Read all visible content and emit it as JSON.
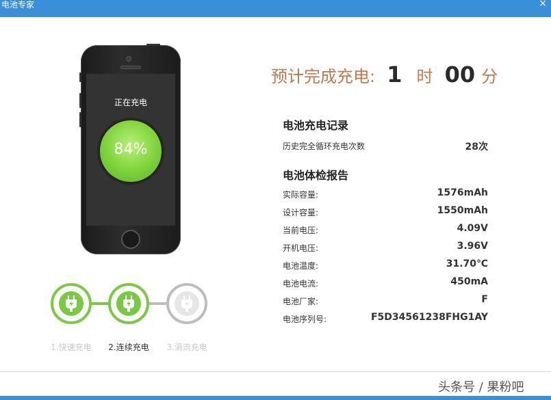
{
  "window": {
    "title": "电池专家",
    "close_glyph": "×"
  },
  "phone": {
    "status_text": "正在充电",
    "percent_text": "84%",
    "charge_level": 0.84
  },
  "steps": [
    {
      "label": "1.快速充电",
      "active": false,
      "icon": "plug-lightning-icon"
    },
    {
      "label": "2.连续充电",
      "active": true,
      "icon": "plug-lightning-icon"
    },
    {
      "label": "3.涓流充电",
      "active": false,
      "icon": "plug-lightning-icon"
    }
  ],
  "eta": {
    "label": "预计完成充电:",
    "hours": "1",
    "hour_unit": "时",
    "minutes": "00",
    "minute_unit": "分"
  },
  "charge_record": {
    "title": "电池充电记录",
    "rows": [
      {
        "label": "历史完全循环充电次数",
        "value": "28次"
      }
    ]
  },
  "health_report": {
    "title": "电池体检报告",
    "rows": [
      {
        "label": "实际容量:",
        "value": "1576mAh"
      },
      {
        "label": "设计容量:",
        "value": "1550mAh"
      },
      {
        "label": "当前电压:",
        "value": "4.09V"
      },
      {
        "label": "开机电压:",
        "value": "3.96V"
      },
      {
        "label": "电池温度:",
        "value": "31.70℃"
      },
      {
        "label": "电池电流:",
        "value": "450mA"
      },
      {
        "label": "电池厂家:",
        "value": "F"
      },
      {
        "label": "电池序列号:",
        "value": "F5D34561238FHG1AY"
      }
    ]
  },
  "watermark": "头条号 / 果粉吧",
  "colors": {
    "titlebar": "#3a8fd9",
    "accent_green": "#7ac943",
    "eta_orange": "#c07a4e"
  }
}
